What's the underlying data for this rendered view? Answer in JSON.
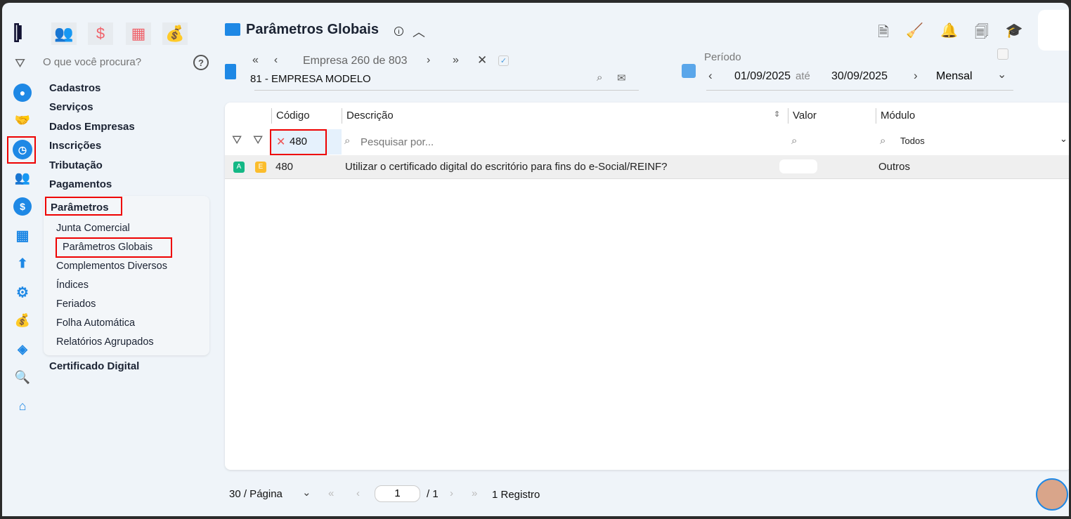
{
  "search": {
    "placeholder": "O que você procura?"
  },
  "menu": {
    "items": [
      "Cadastros",
      "Serviços",
      "Dados Empresas",
      "Inscrições",
      "Tributação",
      "Pagamentos"
    ],
    "active": "Parâmetros",
    "subitems": [
      "Junta Comercial",
      "Parâmetros Globais",
      "Complementos Diversos",
      "Índices",
      "Feriados",
      "Folha Automática",
      "Relatórios Agrupados"
    ],
    "after": "Certificado Digital"
  },
  "header": {
    "title": "Parâmetros Globais"
  },
  "company": {
    "nav_text": "Empresa 260 de 803",
    "name": "81 - EMPRESA MODELO"
  },
  "period": {
    "label": "Período",
    "start": "01/09/2025",
    "sep": "até",
    "end": "30/09/2025",
    "mode": "Mensal"
  },
  "table": {
    "headers": [
      "Código",
      "Descrição",
      "Valor",
      "Módulo"
    ],
    "filter_code": "480",
    "search_placeholder": "Pesquisar por...",
    "module_filter": "Todos",
    "rows": [
      {
        "badge1": "A",
        "badge2": "E",
        "code": "480",
        "description": "Utilizar o certificado digital do escritório para fins do e-Social/REINF?",
        "module": "Outros"
      }
    ]
  },
  "pager": {
    "per_page": "30 / Página",
    "page": "1",
    "total_pages": "/ 1",
    "records": "1 Registro"
  },
  "colors": {
    "accent": "#1e88e5",
    "red": "#f0626a",
    "highlight": "#e00000"
  }
}
